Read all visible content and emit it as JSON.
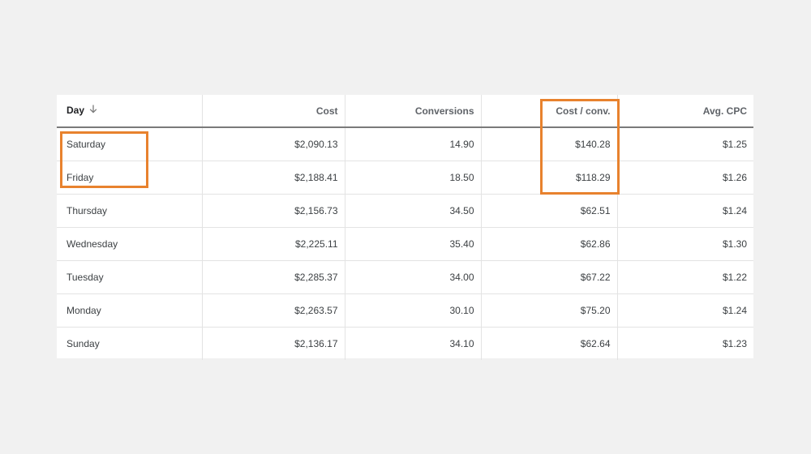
{
  "table": {
    "headers": {
      "day": "Day",
      "cost": "Cost",
      "conversions": "Conversions",
      "cost_per_conv": "Cost / conv.",
      "avg_cpc": "Avg. CPC"
    },
    "sort": {
      "column": "day",
      "direction": "descending",
      "icon": "arrow-down-icon"
    },
    "rows": [
      {
        "day": "Saturday",
        "cost": "$2,090.13",
        "conversions": "14.90",
        "cost_per_conv": "$140.28",
        "avg_cpc": "$1.25"
      },
      {
        "day": "Friday",
        "cost": "$2,188.41",
        "conversions": "18.50",
        "cost_per_conv": "$118.29",
        "avg_cpc": "$1.26"
      },
      {
        "day": "Thursday",
        "cost": "$2,156.73",
        "conversions": "34.50",
        "cost_per_conv": "$62.51",
        "avg_cpc": "$1.24"
      },
      {
        "day": "Wednesday",
        "cost": "$2,225.11",
        "conversions": "35.40",
        "cost_per_conv": "$62.86",
        "avg_cpc": "$1.30"
      },
      {
        "day": "Tuesday",
        "cost": "$2,285.37",
        "conversions": "34.00",
        "cost_per_conv": "$67.22",
        "avg_cpc": "$1.22"
      },
      {
        "day": "Monday",
        "cost": "$2,263.57",
        "conversions": "30.10",
        "cost_per_conv": "$75.20",
        "avg_cpc": "$1.24"
      },
      {
        "day": "Sunday",
        "cost": "$2,136.17",
        "conversions": "34.10",
        "cost_per_conv": "$62.64",
        "avg_cpc": "$1.23"
      }
    ]
  },
  "colors": {
    "page_background": "#f1f1f1",
    "table_background": "#ffffff",
    "highlight_box": "#e8822e",
    "header_rule": "#7a7a7a",
    "gridline": "#e3e3e3"
  }
}
